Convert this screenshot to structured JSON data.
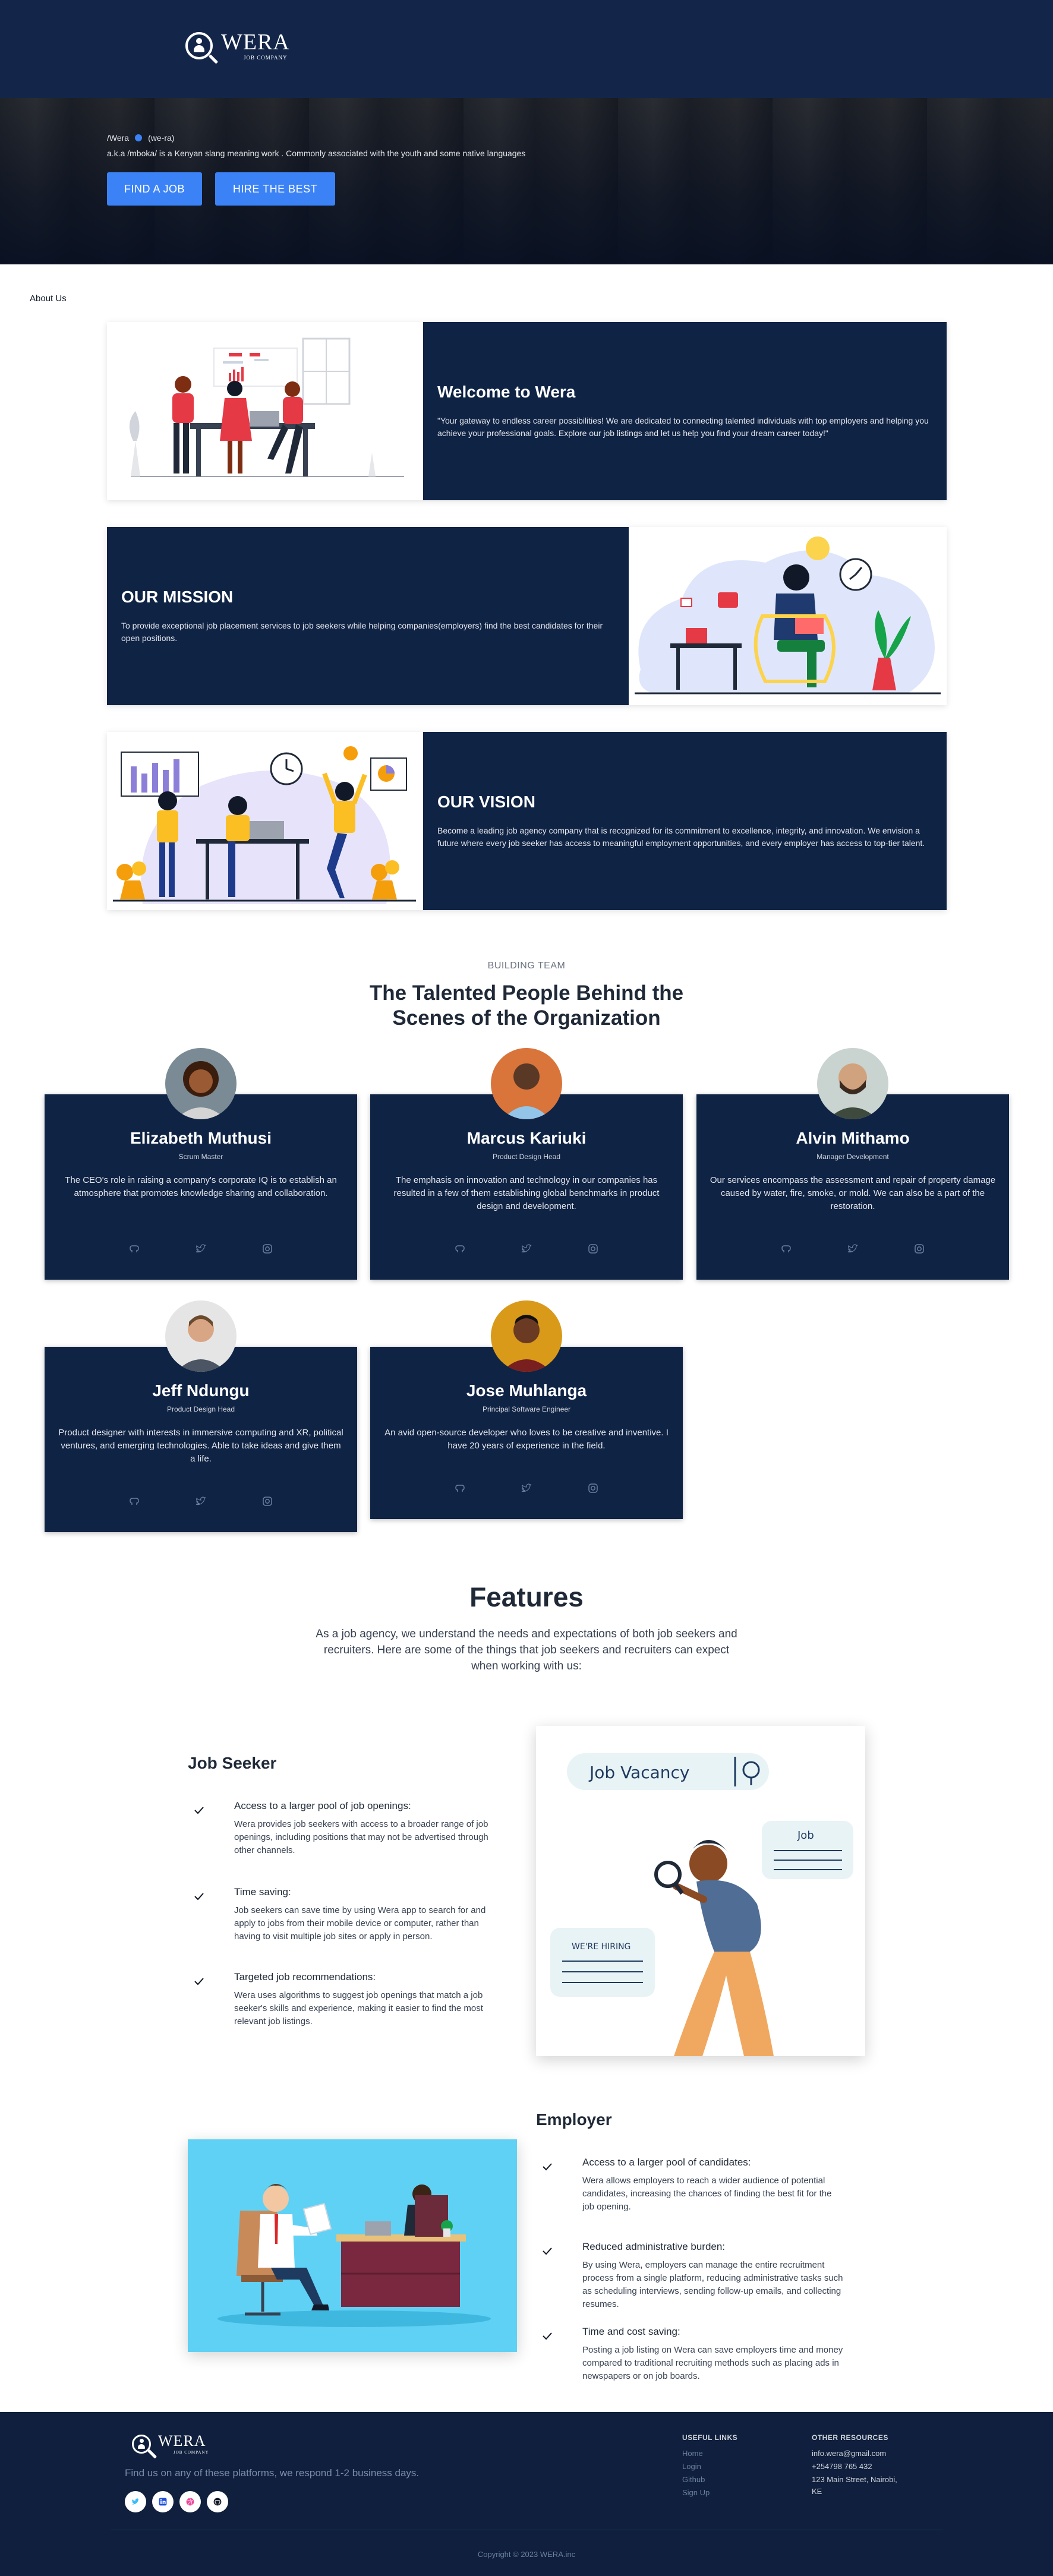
{
  "brand": {
    "name": "WERA",
    "tagline": "JOB COMPANY"
  },
  "hero": {
    "word": "/Wera",
    "pronunciation": "(we-ra)",
    "definition": "a.k.a /mboka/ is a Kenyan slang meaning work . Commonly associated with the youth and some native languages",
    "find_job": "FIND A JOB",
    "hire_best": "HIRE THE BEST"
  },
  "about": {
    "label": "About Us",
    "welcome": {
      "title": "Welcome to Wera",
      "text": "\"Your gateway to endless career possibilities! We are dedicated to connecting talented individuals with top employers and helping you achieve your professional goals. Explore our job listings and let us help you find your dream career today!\""
    },
    "mission": {
      "title": "OUR MISSION",
      "text": "To provide exceptional job placement services to job seekers while helping companies(employers) find the best candidates for their open positions."
    },
    "vision": {
      "title": "OUR VISION",
      "text": "Become a leading job agency company that is recognized for its commitment to excellence, integrity, and innovation. We envision a future where every job seeker has access to meaningful employment opportunities, and every employer has access to top-tier talent."
    }
  },
  "team": {
    "kicker": "BUILDING TEAM",
    "title_line1": "The Talented People Behind the",
    "title_line2": "Scenes of the Organization",
    "members": [
      {
        "name": "Elizabeth Muthusi",
        "role": "Scrum Master",
        "bio": "The CEO's role in raising a company's corporate IQ is to establish an atmosphere that promotes knowledge sharing and collaboration."
      },
      {
        "name": "Marcus Kariuki",
        "role": "Product Design Head",
        "bio": "The emphasis on innovation and technology in our companies has resulted in a few of them establishing global benchmarks in product design and development."
      },
      {
        "name": "Alvin Mithamo",
        "role": "Manager Development",
        "bio": "Our services encompass the assessment and repair of property damage caused by water, fire, smoke, or mold. We can also be a part of the restoration."
      },
      {
        "name": "Jeff Ndungu",
        "role": "Product Design Head",
        "bio": "Product designer with interests in immersive computing and XR, political ventures, and emerging technologies. Able to take ideas and give them a life."
      },
      {
        "name": "Jose Muhlanga",
        "role": "Principal Software Engineer",
        "bio": "An avid open-source developer who loves to be creative and inventive. I have 20 years of experience in the field."
      }
    ]
  },
  "features": {
    "title": "Features",
    "description": "As a job agency, we understand the needs and expectations of both job seekers and recruiters. Here are some of the things that job seekers and recruiters can expect when working with us:",
    "job_seeker": {
      "heading": "Job Seeker",
      "items": [
        {
          "title": "Access to a larger pool of job openings:",
          "text": "Wera provides job seekers with access to a broader range of job openings, including positions that may not be advertised through other channels."
        },
        {
          "title": "Time saving:",
          "text": "Job seekers can save time by using Wera app to search for and apply to jobs from their mobile device or computer, rather than having to visit multiple job sites or apply in person."
        },
        {
          "title": "Targeted job recommendations:",
          "text": "Wera uses algorithms to suggest job openings that match a job seeker's skills and experience, making it easier to find the most relevant job listings."
        }
      ],
      "illustration": {
        "search_label": "Job Vacancy",
        "bubble_job": "Job",
        "bubble_hiring": "WE'RE HIRING"
      }
    },
    "employer": {
      "heading": "Employer",
      "items": [
        {
          "title": "Access to a larger pool of candidates:",
          "text": "Wera allows employers to reach a wider audience of potential candidates, increasing the chances of finding the best fit for the job opening."
        },
        {
          "title": "Reduced administrative burden:",
          "text": "By using Wera, employers can manage the entire recruitment process from a single platform, reducing administrative tasks such as scheduling interviews, sending follow-up emails, and collecting resumes."
        },
        {
          "title": "Time and cost saving:",
          "text": "Posting a job listing on Wera can save employers time and money compared to traditional recruiting methods such as placing ads in newspapers or on job boards."
        }
      ]
    }
  },
  "footer": {
    "tagline": "Find us on any of these platforms, we respond 1-2 business days.",
    "useful_links_heading": "USEFUL LINKS",
    "useful_links": [
      "Home",
      "Login",
      "Github",
      "Sign Up"
    ],
    "other_resources_heading": "OTHER RESOURCES",
    "email": "info.wera@gmail.com",
    "phone": "+254798 765 432",
    "address_line1": "123 Main Street, Nairobi,",
    "address_line2": "KE",
    "copyright": "Copyright © 2023 WERA.inc"
  },
  "colors": {
    "navy": "#0f2345",
    "primary_button": "#3b82f6",
    "footer": "#0f1f3d"
  }
}
